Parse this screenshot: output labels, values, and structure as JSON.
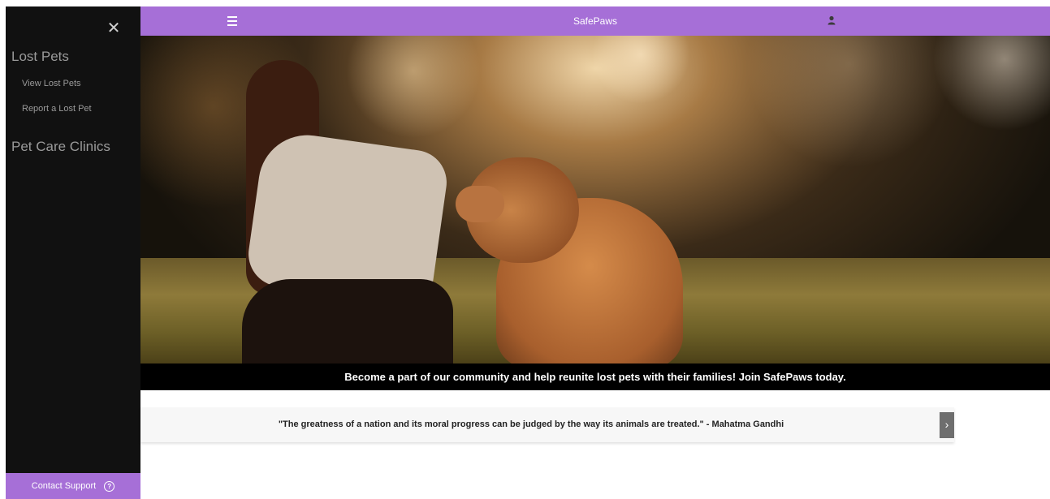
{
  "app": {
    "brand": "SafePaws"
  },
  "sidebar": {
    "close_symbol": "✕",
    "sections": [
      {
        "title": "Lost Pets",
        "items": [
          "View Lost Pets",
          "Report a Lost Pet"
        ]
      },
      {
        "title": "Pet Care Clinics",
        "items": []
      }
    ],
    "support_label": "Contact Support",
    "support_icon": "question-circle-icon"
  },
  "topbar": {
    "menu_icon": "hamburger-icon",
    "user_icon": "user-icon"
  },
  "hero": {
    "image": "woman-with-golden-dog-in-sunlit-field",
    "caption": "Become a part of our community and help reunite lost pets with their families! Join SafePaws today."
  },
  "quote": {
    "text": "\"The greatness of a nation and its moral progress can be judged by the way its animals are treated.\" - Mahatma Gandhi",
    "next_symbol": "›"
  },
  "colors": {
    "accent": "#a66fd7",
    "sidebar_bg": "#111111",
    "caption_bg": "#000000"
  }
}
